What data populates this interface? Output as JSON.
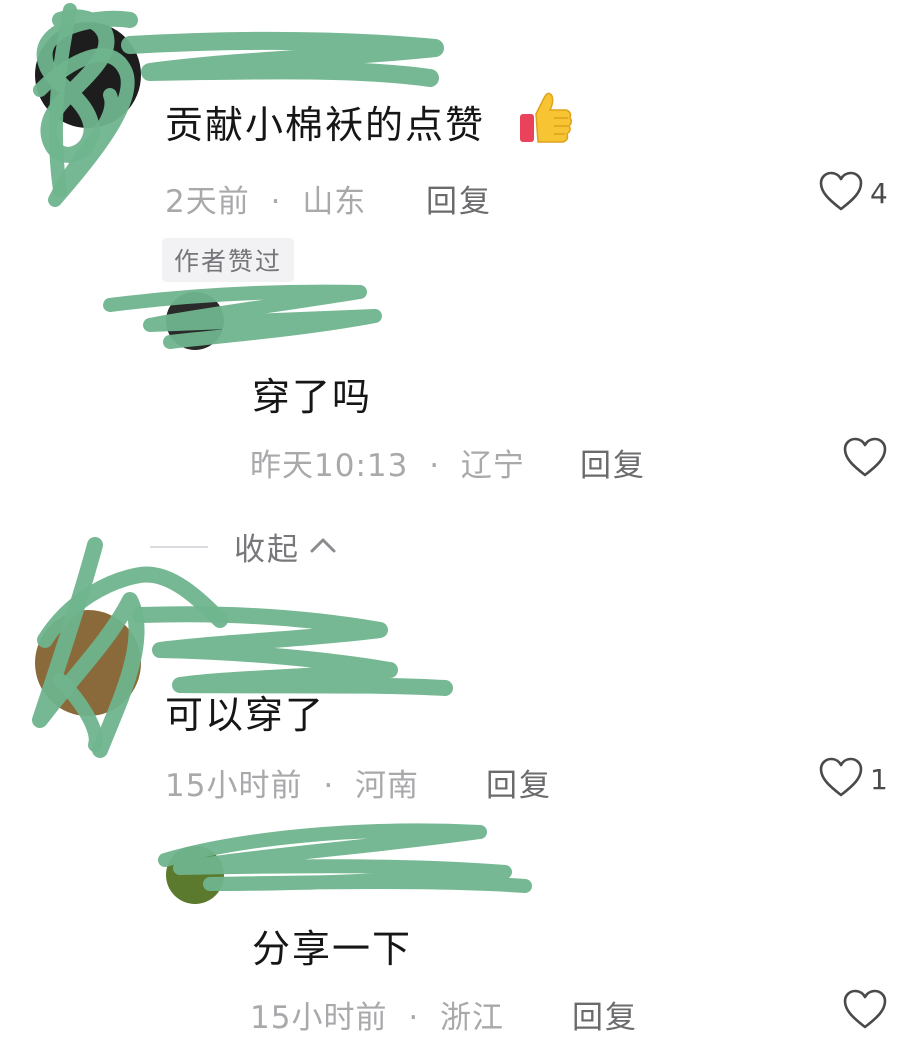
{
  "comments": [
    {
      "text": "贡献小棉袄的点赞",
      "emoji": "thumbs-up-icon",
      "time": "2天前",
      "location": "山东",
      "reply_label": "回复",
      "like_count": "4",
      "badge": "作者赞过",
      "replies": [
        {
          "text": "穿了吗",
          "time": "昨天10:13",
          "location": "辽宁",
          "reply_label": "回复"
        }
      ],
      "collapse_label": "收起"
    },
    {
      "text": "可以穿了",
      "time": "15小时前",
      "location": "河南",
      "reply_label": "回复",
      "like_count": "1",
      "replies": [
        {
          "text": "分享一下",
          "time": "15小时前",
          "location": "浙江",
          "reply_label": "回复"
        }
      ]
    }
  ],
  "separator": "·",
  "colors": {
    "redaction": "#6fb48d",
    "meta_text": "#a9a9ac",
    "reply_text": "#6b6b6e"
  }
}
